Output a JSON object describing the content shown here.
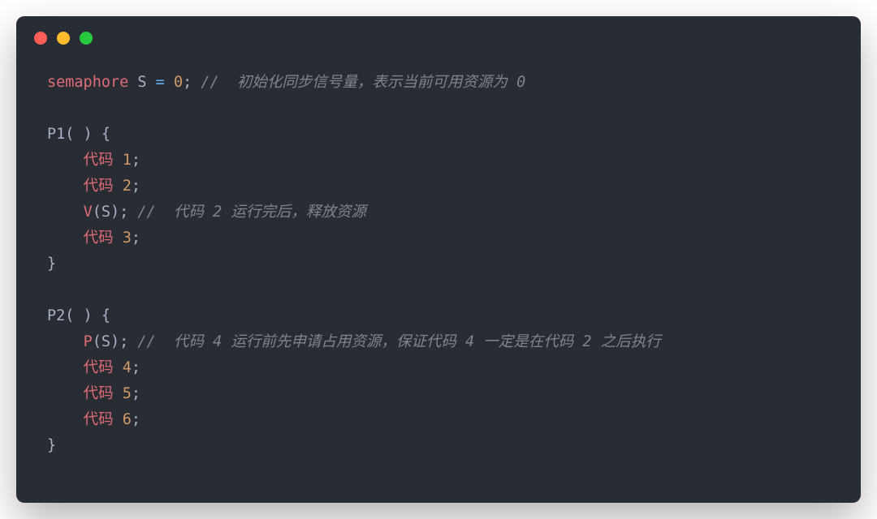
{
  "line1": {
    "type": "semaphore",
    "ident": "S",
    "op": "=",
    "num": "0",
    "punc": ";",
    "comment": "//  初始化同步信号量，表示当前可用资源为 0"
  },
  "p1": {
    "header_name": "P1",
    "header_paren": "( )",
    "header_brace": "{",
    "l1_code": "代码",
    "l1_num": "1",
    "l1_punc": ";",
    "l2_code": "代码",
    "l2_num": "2",
    "l2_punc": ";",
    "l3_call": "V",
    "l3_arg": "(S)",
    "l3_punc": ";",
    "l3_comment": "//  代码 2 运行完后，释放资源",
    "l4_code": "代码",
    "l4_num": "3",
    "l4_punc": ";",
    "close": "}"
  },
  "p2": {
    "header_name": "P2",
    "header_paren": "( )",
    "header_brace": "{",
    "l1_call": "P",
    "l1_arg": "(S)",
    "l1_punc": ";",
    "l1_comment": "//  代码 4 运行前先申请占用资源，保证代码 4 一定是在代码 2 之后执行",
    "l2_code": "代码",
    "l2_num": "4",
    "l2_punc": ";",
    "l3_code": "代码",
    "l3_num": "5",
    "l3_punc": ";",
    "l4_code": "代码",
    "l4_num": "6",
    "l4_punc": ";",
    "close": "}"
  }
}
